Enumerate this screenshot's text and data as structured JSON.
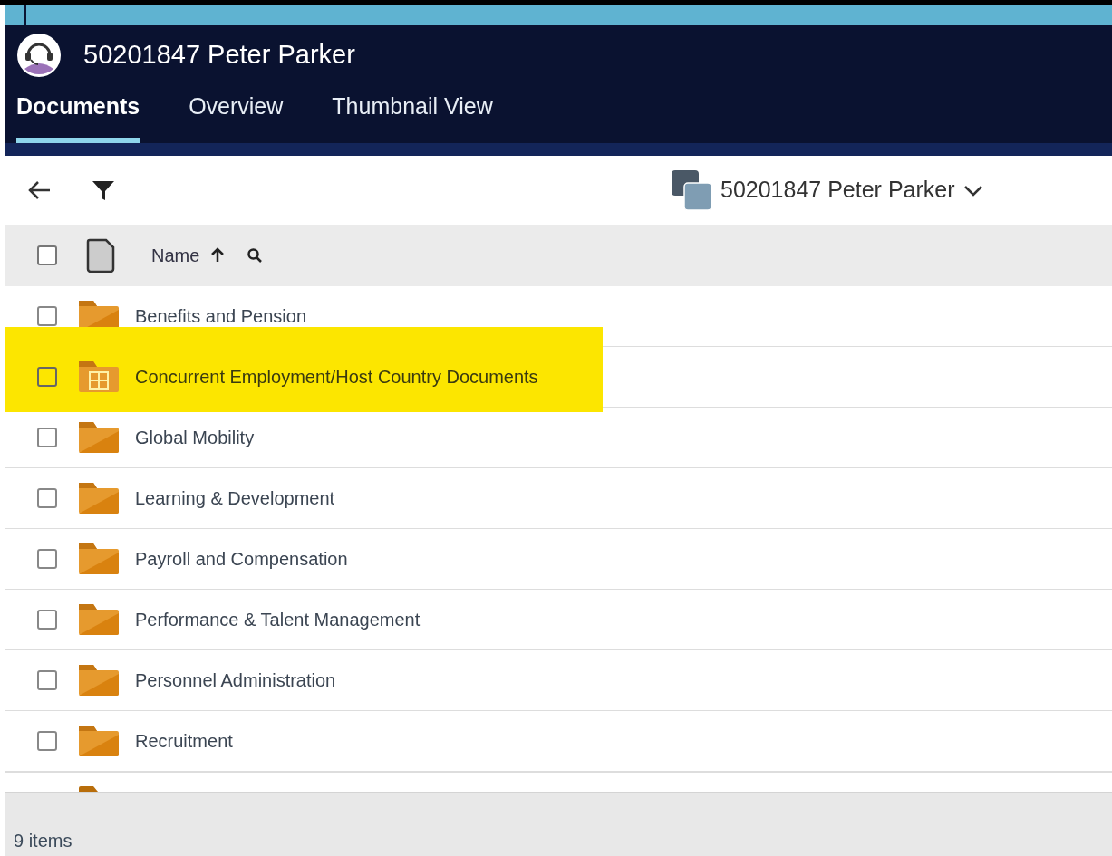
{
  "header": {
    "title": "50201847 Peter Parker"
  },
  "tabs": [
    {
      "label": "Documents",
      "selected": true
    },
    {
      "label": "Overview",
      "selected": false
    },
    {
      "label": "Thumbnail View",
      "selected": false
    }
  ],
  "toolbar": {
    "context": "50201847 Peter Parker"
  },
  "table": {
    "columns": [
      {
        "label": "Name",
        "sort_ascending": true
      }
    ],
    "header_checkbox": {
      "checked": false
    },
    "rows": [
      {
        "name": "Benefits and Pension",
        "kind": "folder",
        "checked": false,
        "highlighted": false
      },
      {
        "name": "Concurrent Employment/Host Country Documents",
        "kind": "grid-folder",
        "checked": false,
        "highlighted": true
      },
      {
        "name": "Global Mobility",
        "kind": "folder",
        "checked": false,
        "highlighted": false
      },
      {
        "name": "Learning & Development",
        "kind": "folder",
        "checked": false,
        "highlighted": false
      },
      {
        "name": "Payroll and Compensation",
        "kind": "folder",
        "checked": false,
        "highlighted": false
      },
      {
        "name": "Performance & Talent Management",
        "kind": "folder",
        "checked": false,
        "highlighted": false
      },
      {
        "name": "Personnel Administration",
        "kind": "folder",
        "checked": false,
        "highlighted": false
      },
      {
        "name": "Recruitment",
        "kind": "folder",
        "checked": false,
        "highlighted": false
      }
    ]
  },
  "status_bar": {
    "count": "9 items"
  }
}
